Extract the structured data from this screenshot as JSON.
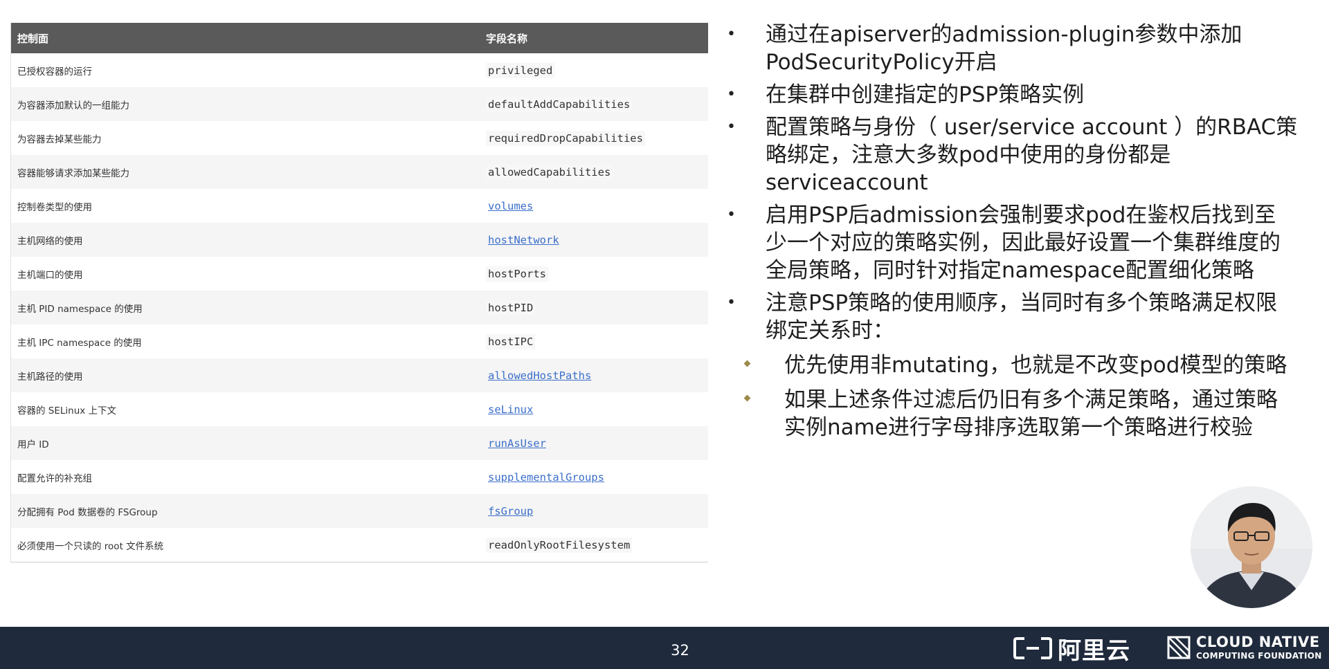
{
  "table": {
    "header_desc": "控制面",
    "header_field": "字段名称",
    "rows": [
      {
        "desc": "已授权容器的运行",
        "field": "privileged",
        "link": false
      },
      {
        "desc": "为容器添加默认的一组能力",
        "field": "defaultAddCapabilities",
        "link": false
      },
      {
        "desc": "为容器去掉某些能力",
        "field": "requiredDropCapabilities",
        "link": false
      },
      {
        "desc": "容器能够请求添加某些能力",
        "field": "allowedCapabilities",
        "link": false
      },
      {
        "desc": "控制卷类型的使用",
        "field": "volumes",
        "link": true
      },
      {
        "desc": "主机网络的使用",
        "field": "hostNetwork",
        "link": true
      },
      {
        "desc": "主机端口的使用",
        "field": "hostPorts",
        "link": false
      },
      {
        "desc": "主机 PID namespace 的使用",
        "field": "hostPID",
        "link": false
      },
      {
        "desc": "主机 IPC namespace 的使用",
        "field": "hostIPC",
        "link": false
      },
      {
        "desc": "主机路径的使用",
        "field": "allowedHostPaths",
        "link": true
      },
      {
        "desc": "容器的 SELinux 上下文",
        "field": "seLinux",
        "link": true
      },
      {
        "desc": "用户 ID",
        "field": "runAsUser",
        "link": true
      },
      {
        "desc": "配置允许的补充组",
        "field": "supplementalGroups",
        "link": true
      },
      {
        "desc": "分配拥有 Pod 数据卷的 FSGroup",
        "field": "fsGroup",
        "link": true
      },
      {
        "desc": "必须使用一个只读的 root 文件系统",
        "field": "readOnlyRootFilesystem",
        "link": false
      }
    ]
  },
  "bullets": [
    {
      "level": 1,
      "lines": [
        "通过在apiserver的admission-plugin参数中添加",
        "PodSecurityPolicy开启"
      ]
    },
    {
      "level": 1,
      "lines": [
        "在集群中创建指定的PSP策略实例"
      ]
    },
    {
      "level": 1,
      "lines": [
        "配置策略与身份（ user/service account ）的RBAC策",
        "略绑定，注意大多数pod中使用的身份都是",
        "serviceaccount"
      ]
    },
    {
      "level": 1,
      "lines": [
        "启用PSP后admission会强制要求pod在鉴权后找到至",
        "少一个对应的策略实例，因此最好设置一个集群维度的",
        "全局策略，同时针对指定namespace配置细化策略"
      ]
    },
    {
      "level": 1,
      "lines": [
        "注意PSP策略的使用顺序，当同时有多个策略满足权限",
        "绑定关系时："
      ]
    },
    {
      "level": 2,
      "lines": [
        "优先使用非mutating，也就是不改变pod模型的策略"
      ]
    },
    {
      "level": 2,
      "lines": [
        "如果上述条件过滤后仍旧有多个满足策略，通过策略",
        "实例name进行字母排序选取第一个策略进行校验"
      ]
    }
  ],
  "footer": {
    "page_number": "32",
    "aliyun_text": "阿里云",
    "cncf_line1": "CLOUD NATIVE",
    "cncf_line2": "COMPUTING FOUNDATION"
  },
  "colors": {
    "footer_bg": "#1f2a3c",
    "table_header_bg": "#5a5a5a",
    "link": "#3b6ec9",
    "sub_bullet": "#9c8a4a"
  }
}
